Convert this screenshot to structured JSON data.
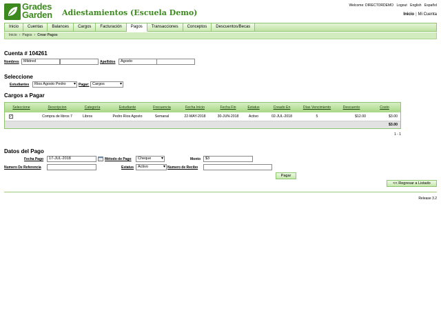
{
  "header": {
    "logo_line1": "Grades",
    "logo_line2": "Garden",
    "app_title": "Adiestamientos (Escuela Demo)",
    "welcome": "Welcome: DIRECTORDEMO",
    "logout": "Logout",
    "english": "English",
    "espanol": "Español",
    "inicio": "Inicio",
    "separator": "|",
    "mi_cuenta": "Mi Cuenta"
  },
  "nav": {
    "tabs": [
      "Inicio",
      "Cuentas",
      "Balances",
      "Cargos",
      "Facturación",
      "Pagos",
      "Transacciones",
      "Conceptos",
      "Descuentos/Becas"
    ],
    "active": "Pagos"
  },
  "breadcrumb": {
    "items": [
      "Inicio",
      "Pagos",
      "Crear Pagos"
    ],
    "separator": "›"
  },
  "cuenta": {
    "title": "Cuenta # 104261",
    "nombres_label": "Nombres",
    "nombres_value": "Mildred",
    "nombres_value2": "",
    "apellidos_label": "Apellidos",
    "apellidos_value": "Agosto",
    "apellidos_value2": ""
  },
  "seleccione": {
    "title": "Seleccione",
    "estudiantes_label": "Estudiantes",
    "estudiantes_value": "Rios Agosto Pedro",
    "pagar_label": "Pagar:",
    "pagar_value": "Cargos"
  },
  "cargos": {
    "title": "Cargos a Pagar",
    "columns": [
      "Seleccione",
      "Descripcion",
      "Categoría",
      "Estudiante",
      "Frecuencia",
      "Fecha Inicio",
      "Fecha Fin",
      "Estatus",
      "Creado En",
      "Días Vencimiento",
      "Descuento",
      "Costo"
    ],
    "rows": [
      {
        "check": "✓",
        "descripcion": "Compra de libros 7",
        "categoria": "Libros",
        "estudiante": "Pedro Rios Agosto",
        "frecuencia": "Semanal",
        "fecha_inicio": "22-MAY-2018",
        "fecha_fin": "30-JUN-2018",
        "estatus": "Activo",
        "creado_en": "02-JUL-2018",
        "dias": "5",
        "descuento": "$12.00",
        "costo": "$3.00"
      }
    ],
    "total": "$3.00",
    "pager": "1 - 1"
  },
  "pago": {
    "title": "Datos del Pago",
    "fecha_label": "Fecha Pago",
    "fecha_value": "17-JUL-2018",
    "metodo_label": "Método de Pago",
    "metodo_value": "Cheque",
    "monto_label": "Monto",
    "monto_value": "$3",
    "referencia_label": "Numero De Referencia",
    "referencia_value": "",
    "estatus_label": "Estatus",
    "estatus_value": "Activo",
    "recibo_label": "Numero de Recibo",
    "recibo_value": "",
    "pagar_button": "Pagar",
    "regresar_button": "<< Regresar a Listado"
  },
  "footer": {
    "release": "Release 3.2"
  },
  "colors": {
    "brand_green": "#3c8a1e",
    "nav_border": "#8fc46e"
  }
}
